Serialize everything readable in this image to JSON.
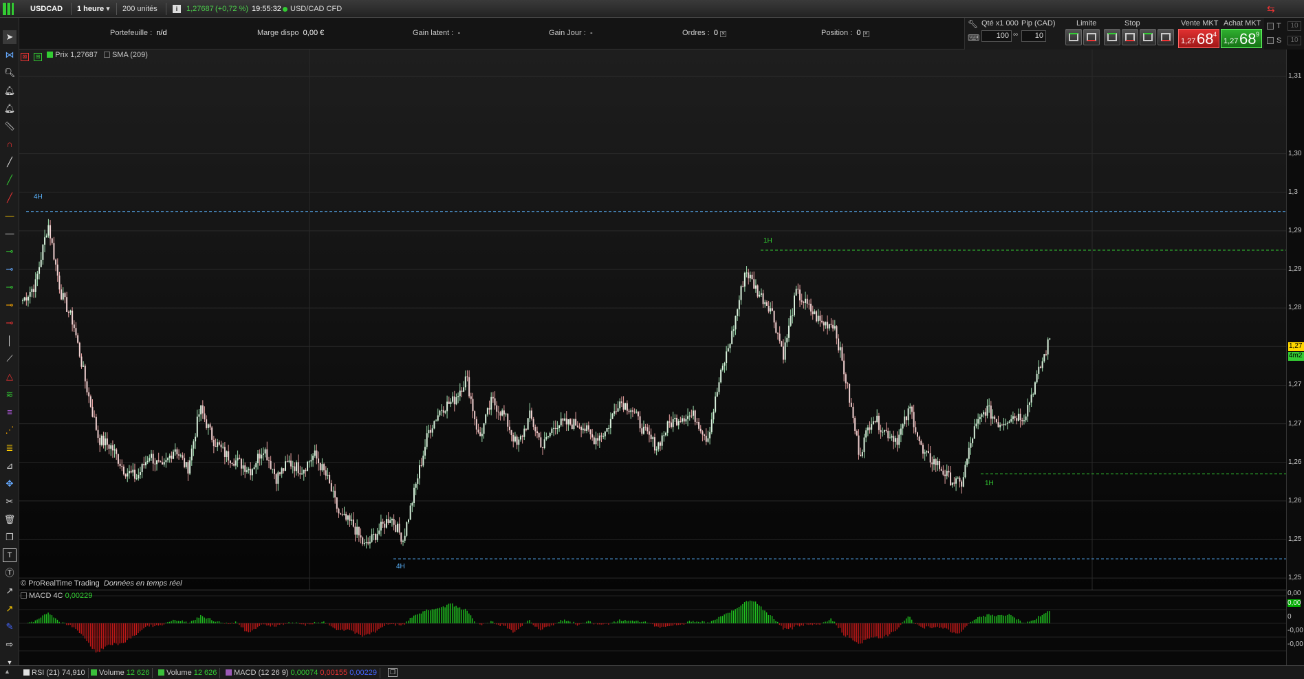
{
  "header": {
    "symbol": "USDCAD",
    "timeframe": "1 heure",
    "units": "200 unités",
    "last_price": "1,27687",
    "change": "(+0,72 %)",
    "time": "19:55:32",
    "instrument": "USD/CAD CFD"
  },
  "account": {
    "portefeuille_label": "Portefeuille :",
    "portefeuille_value": "n/d",
    "marge_label": "Marge dispo",
    "marge_value": "0,00 €",
    "gain_latent_label": "Gain latent :",
    "gain_latent_value": "-",
    "gain_jour_label": "Gain Jour :",
    "gain_jour_value": "-",
    "ordres_label": "Ordres :",
    "ordres_value": "0",
    "position_label": "Position :",
    "position_value": "0"
  },
  "trade": {
    "qty_label": "Qté x1 000",
    "qty_value": "100",
    "pip_label": "Pip (CAD)",
    "pip_value": "10",
    "limite_label": "Limite",
    "stop_label": "Stop",
    "sell_label": "Vente MKT",
    "sell_small": "1,27",
    "sell_big": "68",
    "sell_sup": "4",
    "buy_label": "Achat MKT",
    "buy_small": "1,27",
    "buy_big": "68",
    "buy_sup": "9",
    "t_label": "T",
    "s_label": "S",
    "t_value": "10",
    "s_value": "10"
  },
  "legend": {
    "price_label": "Prix",
    "price_value": "1,27687",
    "sma_label": "SMA (209)"
  },
  "chart_annotations": {
    "level_4h_top": "4H",
    "level_1h_top": "1H",
    "level_1h_bottom": "1H",
    "level_4h_bottom": "4H",
    "watermark": "© ProRealTime Trading",
    "watermark2": "Données en temps réel"
  },
  "price_axis": [
    "1,31",
    "1,30",
    "1,3",
    "1,29",
    "1,29",
    "1,28",
    "1,28",
    "1,27",
    "1,27",
    "1,26",
    "1,26",
    "1,25",
    "1,25"
  ],
  "current_price_tag": "1,27",
  "current_price_tag2": "4m2",
  "macd_panel": {
    "label": "MACD 4C",
    "value": "0,00229",
    "axis": [
      "0,00",
      "0,00",
      "0",
      "-0,00",
      "-0,00"
    ]
  },
  "bottom_tabs": [
    {
      "label": "RSI (21)",
      "value": "74,910",
      "color": "#e0e0e0"
    },
    {
      "label": "Volume",
      "value": "12 626",
      "color": "#3bbf3b"
    },
    {
      "label": "Volume",
      "value": "12 626",
      "color": "#3bbf3b"
    },
    {
      "label": "MACD (12 26 9)",
      "value": "0,00074",
      "value2": "0,00155",
      "value3": "0,00229",
      "color": "#9b59b6"
    }
  ],
  "chart_data": {
    "type": "candlestick",
    "symbol": "USDCAD",
    "timeframe": "1 heure",
    "price_levels": [
      1.31,
      1.3,
      1.295,
      1.29,
      1.285,
      1.28,
      1.275,
      1.27,
      1.265,
      1.26,
      1.255,
      1.25,
      1.245
    ],
    "close_path": [
      1.281,
      1.283,
      1.291,
      1.282,
      1.278,
      1.27,
      1.263,
      1.262,
      1.259,
      1.258,
      1.261,
      1.259,
      1.262,
      1.259,
      1.267,
      1.263,
      1.261,
      1.26,
      1.259,
      1.262,
      1.258,
      1.26,
      1.259,
      1.261,
      1.258,
      1.253,
      1.252,
      1.249,
      1.251,
      1.253,
      1.25,
      1.257,
      1.264,
      1.267,
      1.268,
      1.271,
      1.263,
      1.268,
      1.266,
      1.262,
      1.266,
      1.262,
      1.265,
      1.265,
      1.265,
      1.263,
      1.264,
      1.268,
      1.267,
      1.264,
      1.262,
      1.265,
      1.266,
      1.266,
      1.263,
      1.271,
      1.277,
      1.285,
      1.282,
      1.28,
      1.274,
      1.282,
      1.28,
      1.278,
      1.278,
      1.27,
      1.261,
      1.266,
      1.264,
      1.263,
      1.267,
      1.261,
      1.26,
      1.258,
      1.257,
      1.264,
      1.267,
      1.265,
      1.266,
      1.266,
      1.271,
      1.276
    ],
    "levels": {
      "4H_high": 1.2925,
      "1H_high": 1.2875,
      "1H_low": 1.2585,
      "4H_low": 1.2475
    }
  }
}
